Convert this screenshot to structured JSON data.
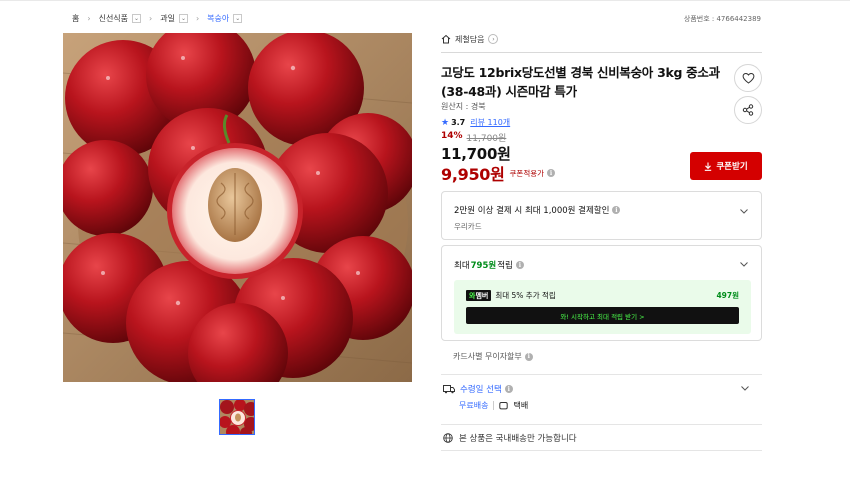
{
  "breadcrumb": [
    {
      "label": "홈"
    },
    {
      "label": "신선식품"
    },
    {
      "label": "과일"
    },
    {
      "label": "복숭아"
    }
  ],
  "product_no": "상품번호 : 4766442389",
  "brand": "제철담음",
  "title": "고당도 12brix당도선별 경북 신비복숭아 3kg 중소과 (38-48과) 시즌마감 특가",
  "origin": "원산지 : 경북",
  "rating": {
    "score": "3.7",
    "reviews": "리뷰 110개"
  },
  "discount": {
    "percent": "14%",
    "original": "11,700원"
  },
  "price": "11,700원",
  "coupon_price": {
    "value": "9,950원",
    "label": "쿠폰적용가"
  },
  "coupon_button": "쿠폰받기",
  "card_benefit": {
    "line1": "2만원 이상 결제 시 최대 1,000원 결제할인",
    "line2": "우리카드"
  },
  "points": {
    "prefix": "최대 ",
    "amount": "795원",
    "suffix": " 적립",
    "wow_badge_a": "와",
    "wow_badge_b": "멤버",
    "wow_text": "최대 5% 추가 적립",
    "wow_amount": "497원",
    "wow_button": "와! 시작하고 최대 적립 받기  >"
  },
  "installment": "카드사별 무이자할부",
  "delivery": {
    "title": "수령일 선택",
    "free": "무료배송",
    "pkg": "택배"
  },
  "domestic": "본 상품은 국내배송만 가능합니다",
  "colors": {
    "accent_blue": "#346aff",
    "price_red": "#ae0000",
    "button_red": "#d40000",
    "wow_green": "#008c1a"
  }
}
